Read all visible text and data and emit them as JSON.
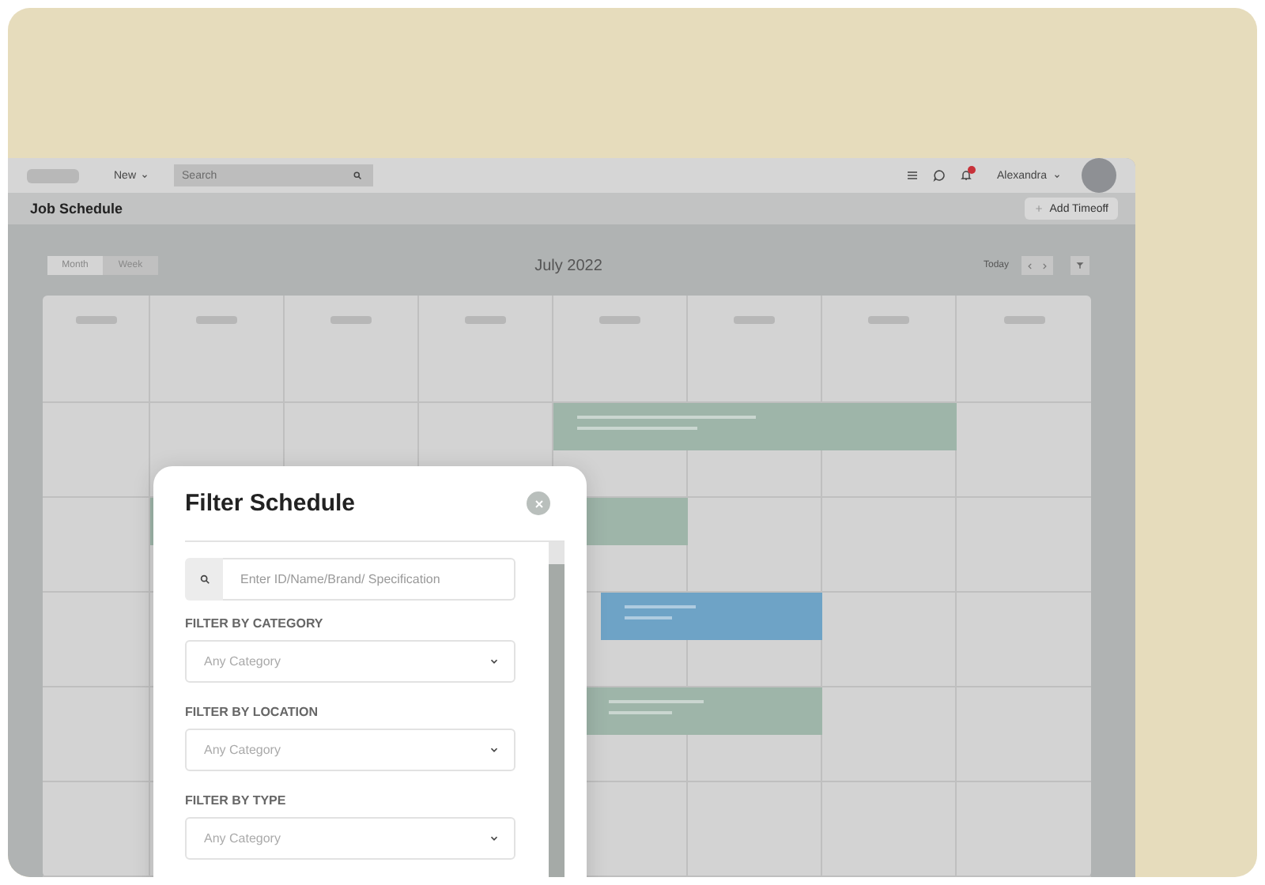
{
  "topbar": {
    "new_menu": "New",
    "search": {
      "placeholder": "Search"
    },
    "user_name": "Alexandra",
    "notification_badge": true
  },
  "page": {
    "title": "Job Schedule",
    "add_button": "Add Timeoff"
  },
  "calendar": {
    "views": [
      {
        "label": "Month",
        "selected": true
      },
      {
        "label": "Week",
        "selected": false
      }
    ],
    "month": "July 2022",
    "today_button": "Today"
  },
  "filter_modal": {
    "title": "Filter Schedule",
    "search": {
      "placeholder": "Enter ID/Name/Brand/ Specification"
    },
    "filters": [
      {
        "label": "FILTER BY CATEGORY",
        "placeholder": "Any Category"
      },
      {
        "label": "FILTER BY LOCATION",
        "placeholder": "Any Category"
      },
      {
        "label": "FILTER BY TYPE",
        "placeholder": "Any Category"
      }
    ]
  }
}
